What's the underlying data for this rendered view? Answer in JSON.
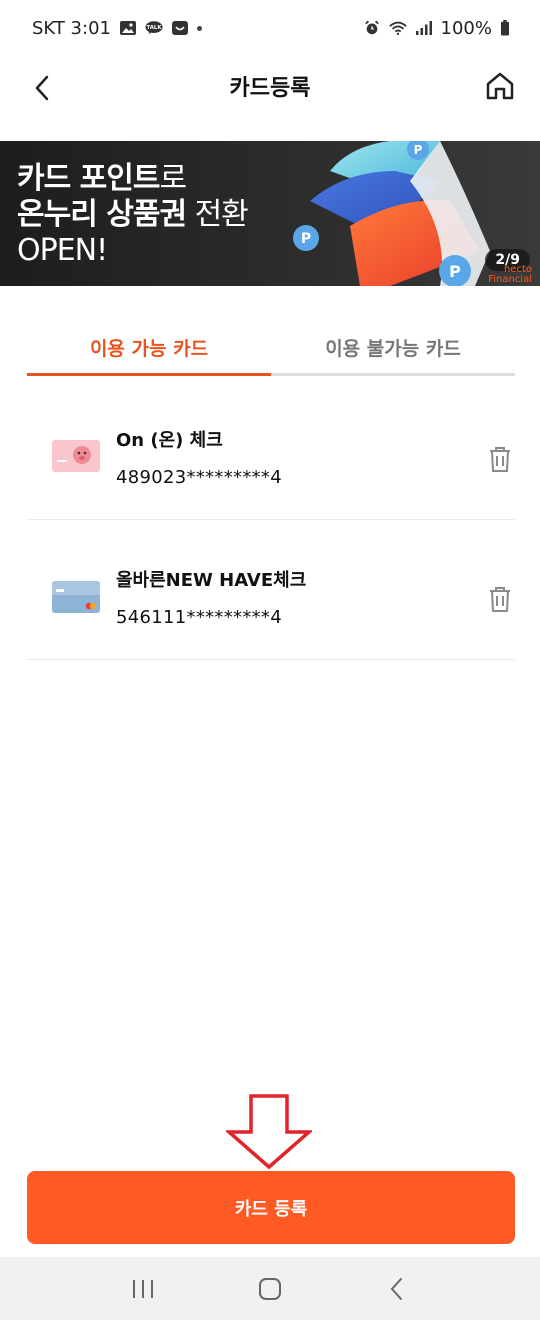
{
  "status_bar": {
    "carrier_time": "SKT 3:01",
    "battery": "100%"
  },
  "header": {
    "title": "카드등록"
  },
  "banner": {
    "line1_bold": "카드 포인트",
    "line1_rest": "로",
    "line2_bold": "온누리 상품권",
    "line2_rest": " 전환",
    "line3": "OPEN!",
    "page_indicator": "2/9"
  },
  "tabs": [
    {
      "label": "이용 가능 카드",
      "active": true
    },
    {
      "label": "이용 불가능 카드",
      "active": false
    }
  ],
  "cards": [
    {
      "name": "On (온) 체크",
      "number": "489023*********4"
    },
    {
      "name": "올바른NEW HAVE체크",
      "number": "546111*********4"
    }
  ],
  "register_button": {
    "label": "카드 등록"
  },
  "colors": {
    "accent": "#ff5a23",
    "tab_active": "#e8541f",
    "annotation_arrow": "#e0242a"
  }
}
